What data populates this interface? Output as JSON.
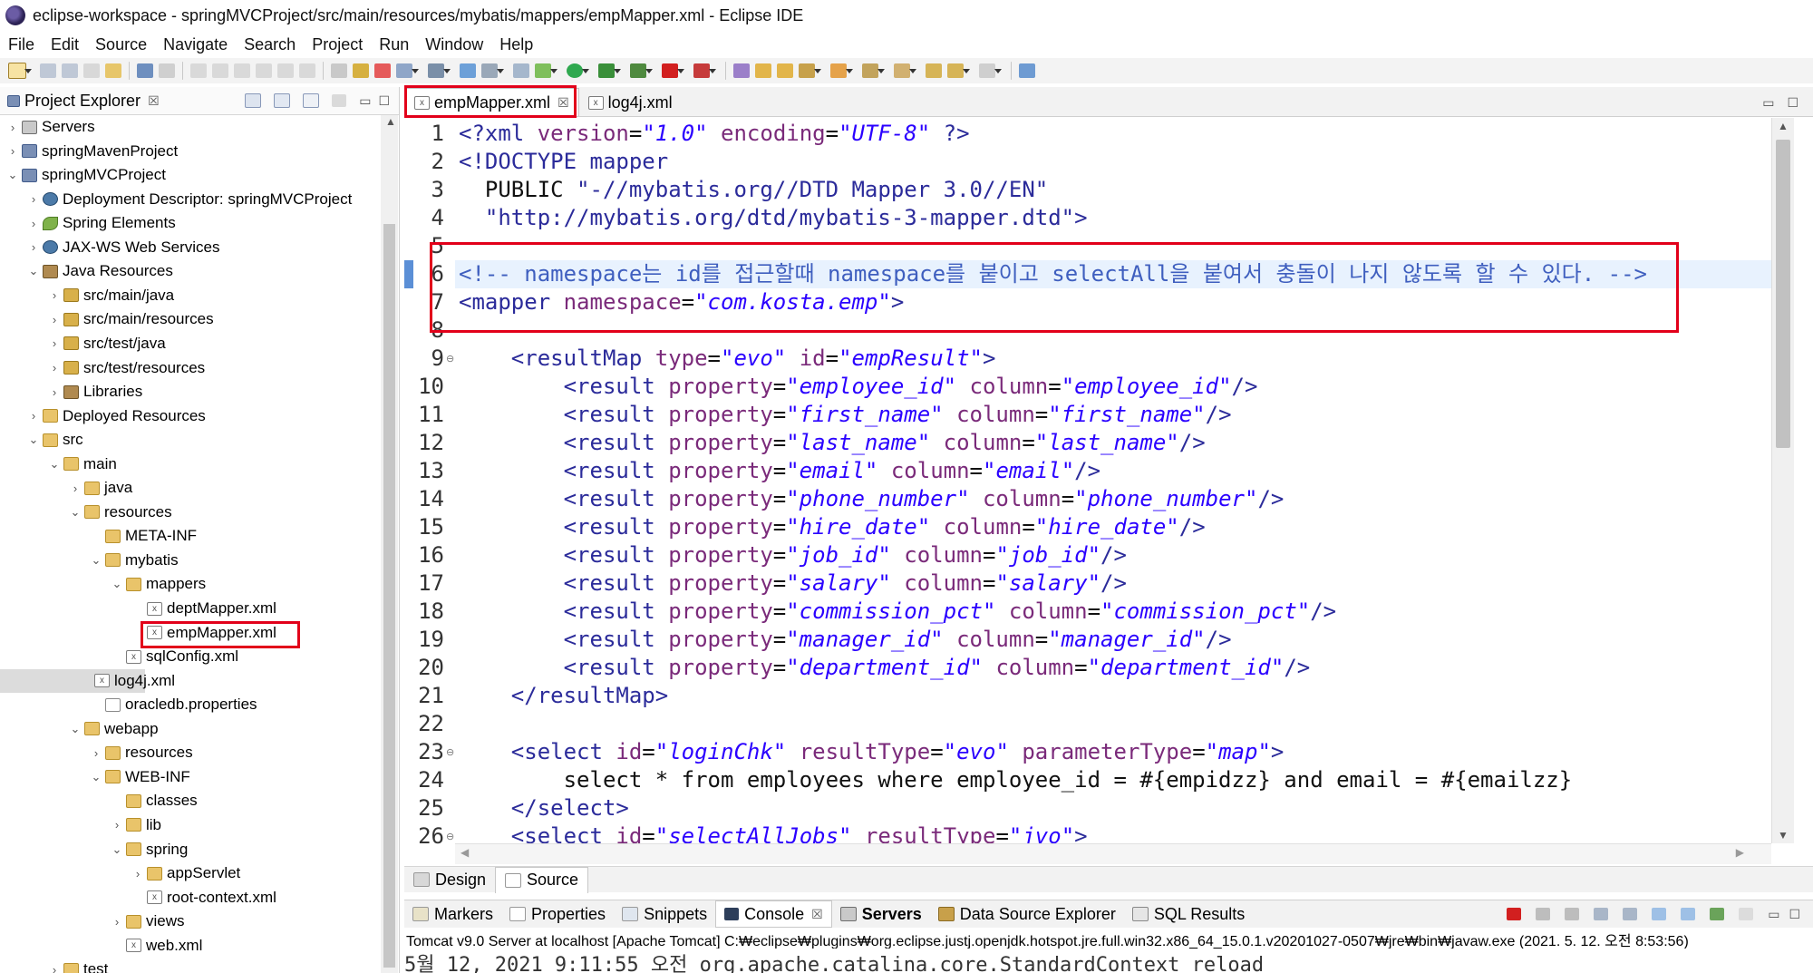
{
  "window": {
    "title": "eclipse-workspace - springMVCProject/src/main/resources/mybatis/mappers/empMapper.xml - Eclipse IDE"
  },
  "menu": [
    "File",
    "Edit",
    "Source",
    "Navigate",
    "Search",
    "Project",
    "Run",
    "Window",
    "Help"
  ],
  "explorer": {
    "title": "Project Explorer",
    "close": "☒",
    "items": [
      {
        "label": "Servers",
        "depth": 0,
        "twisty": "›",
        "icon": "srv"
      },
      {
        "label": "springMavenProject",
        "depth": 0,
        "twisty": "›",
        "icon": "proj"
      },
      {
        "label": "springMVCProject",
        "depth": 0,
        "twisty": "⌄",
        "icon": "proj"
      },
      {
        "label": "Deployment Descriptor: springMVCProject",
        "depth": 1,
        "twisty": "›",
        "icon": "web"
      },
      {
        "label": "Spring Elements",
        "depth": 1,
        "twisty": "›",
        "icon": "leaf"
      },
      {
        "label": "JAX-WS Web Services",
        "depth": 1,
        "twisty": "›",
        "icon": "web"
      },
      {
        "label": "Java Resources",
        "depth": 1,
        "twisty": "⌄",
        "icon": "lib"
      },
      {
        "label": "src/main/java",
        "depth": 2,
        "twisty": "›",
        "icon": "pkg"
      },
      {
        "label": "src/main/resources",
        "depth": 2,
        "twisty": "›",
        "icon": "pkg"
      },
      {
        "label": "src/test/java",
        "depth": 2,
        "twisty": "›",
        "icon": "pkg"
      },
      {
        "label": "src/test/resources",
        "depth": 2,
        "twisty": "›",
        "icon": "pkg"
      },
      {
        "label": "Libraries",
        "depth": 2,
        "twisty": "›",
        "icon": "lib"
      },
      {
        "label": "Deployed Resources",
        "depth": 1,
        "twisty": "›",
        "icon": "folder"
      },
      {
        "label": "src",
        "depth": 1,
        "twisty": "⌄",
        "icon": "folder"
      },
      {
        "label": "main",
        "depth": 2,
        "twisty": "⌄",
        "icon": "folder"
      },
      {
        "label": "java",
        "depth": 3,
        "twisty": "›",
        "icon": "folder"
      },
      {
        "label": "resources",
        "depth": 3,
        "twisty": "⌄",
        "icon": "folder"
      },
      {
        "label": "META-INF",
        "depth": 4,
        "twisty": "",
        "icon": "folder"
      },
      {
        "label": "mybatis",
        "depth": 4,
        "twisty": "⌄",
        "icon": "folder"
      },
      {
        "label": "mappers",
        "depth": 5,
        "twisty": "⌄",
        "icon": "folder"
      },
      {
        "label": "deptMapper.xml",
        "depth": 6,
        "twisty": "",
        "icon": "xml"
      },
      {
        "label": "empMapper.xml",
        "depth": 6,
        "twisty": "",
        "icon": "xml"
      },
      {
        "label": "sqlConfig.xml",
        "depth": 5,
        "twisty": "",
        "icon": "xml"
      },
      {
        "label": "log4j.xml",
        "depth": 4,
        "twisty": "",
        "icon": "xml"
      },
      {
        "label": "oracledb.properties",
        "depth": 4,
        "twisty": "",
        "icon": "file"
      },
      {
        "label": "webapp",
        "depth": 3,
        "twisty": "⌄",
        "icon": "folder"
      },
      {
        "label": "resources",
        "depth": 4,
        "twisty": "›",
        "icon": "folder"
      },
      {
        "label": "WEB-INF",
        "depth": 4,
        "twisty": "⌄",
        "icon": "folder"
      },
      {
        "label": "classes",
        "depth": 5,
        "twisty": "",
        "icon": "folder"
      },
      {
        "label": "lib",
        "depth": 5,
        "twisty": "›",
        "icon": "folder"
      },
      {
        "label": "spring",
        "depth": 5,
        "twisty": "⌄",
        "icon": "folder"
      },
      {
        "label": "appServlet",
        "depth": 6,
        "twisty": "›",
        "icon": "folder"
      },
      {
        "label": "root-context.xml",
        "depth": 6,
        "twisty": "",
        "icon": "xml"
      },
      {
        "label": "views",
        "depth": 5,
        "twisty": "›",
        "icon": "folder"
      },
      {
        "label": "web.xml",
        "depth": 5,
        "twisty": "",
        "icon": "xml"
      },
      {
        "label": "test",
        "depth": 2,
        "twisty": "›",
        "icon": "folder"
      }
    ]
  },
  "editor": {
    "tabs": [
      {
        "label": "empMapper.xml",
        "close": "☒"
      },
      {
        "label": "log4j.xml",
        "close": ""
      }
    ],
    "lines": [
      {
        "n": "1",
        "fold": "",
        "segs": [
          [
            "tag",
            "<?xml "
          ],
          [
            "attr",
            "version"
          ],
          [
            "plain",
            "="
          ],
          [
            "val",
            "\"1.0\""
          ],
          [
            "plain",
            " "
          ],
          [
            "attr",
            "encoding"
          ],
          [
            "plain",
            "="
          ],
          [
            "val",
            "\"UTF-8\""
          ],
          [
            "tag",
            " ?>"
          ]
        ]
      },
      {
        "n": "2",
        "fold": "",
        "segs": [
          [
            "tag",
            "<!DOCTYPE mapper"
          ]
        ]
      },
      {
        "n": "3",
        "fold": "",
        "segs": [
          [
            "plain",
            "  PUBLIC "
          ],
          [
            "tag",
            "\"-//mybatis.org//DTD Mapper 3.0//EN\""
          ]
        ]
      },
      {
        "n": "4",
        "fold": "",
        "segs": [
          [
            "tag",
            "  \"http://mybatis.org/dtd/mybatis-3-mapper.dtd\">"
          ]
        ]
      },
      {
        "n": "5",
        "fold": "",
        "segs": []
      },
      {
        "n": "6",
        "fold": "",
        "segs": [
          [
            "cmt",
            "<!-- namespace는 id를 접근할때 namespace를 붙이고 selectAll을 붙여서 충돌이 나지 않도록 할 수 있다. -->"
          ]
        ]
      },
      {
        "n": "7",
        "fold": "",
        "segs": [
          [
            "tag",
            "<mapper "
          ],
          [
            "attr",
            "namespace"
          ],
          [
            "plain",
            "="
          ],
          [
            "val",
            "\"com.kosta.emp\""
          ],
          [
            "tag",
            ">"
          ]
        ]
      },
      {
        "n": "8",
        "fold": "",
        "segs": []
      },
      {
        "n": "9",
        "fold": "⊖",
        "segs": [
          [
            "plain",
            "    "
          ],
          [
            "tag",
            "<resultMap "
          ],
          [
            "attr",
            "type"
          ],
          [
            "plain",
            "="
          ],
          [
            "val",
            "\"evo\""
          ],
          [
            "plain",
            " "
          ],
          [
            "attr",
            "id"
          ],
          [
            "plain",
            "="
          ],
          [
            "val",
            "\"empResult\""
          ],
          [
            "tag",
            ">"
          ]
        ]
      },
      {
        "n": "10",
        "fold": "",
        "segs": [
          [
            "plain",
            "        "
          ],
          [
            "tag",
            "<result "
          ],
          [
            "attr",
            "property"
          ],
          [
            "plain",
            "="
          ],
          [
            "val",
            "\"employee_id\""
          ],
          [
            "plain",
            " "
          ],
          [
            "attr",
            "column"
          ],
          [
            "plain",
            "="
          ],
          [
            "val",
            "\"employee_id\""
          ],
          [
            "tag",
            "/>"
          ]
        ]
      },
      {
        "n": "11",
        "fold": "",
        "segs": [
          [
            "plain",
            "        "
          ],
          [
            "tag",
            "<result "
          ],
          [
            "attr",
            "property"
          ],
          [
            "plain",
            "="
          ],
          [
            "val",
            "\"first_name\""
          ],
          [
            "plain",
            " "
          ],
          [
            "attr",
            "column"
          ],
          [
            "plain",
            "="
          ],
          [
            "val",
            "\"first_name\""
          ],
          [
            "tag",
            "/>"
          ]
        ]
      },
      {
        "n": "12",
        "fold": "",
        "segs": [
          [
            "plain",
            "        "
          ],
          [
            "tag",
            "<result "
          ],
          [
            "attr",
            "property"
          ],
          [
            "plain",
            "="
          ],
          [
            "val",
            "\"last_name\""
          ],
          [
            "plain",
            " "
          ],
          [
            "attr",
            "column"
          ],
          [
            "plain",
            "="
          ],
          [
            "val",
            "\"last_name\""
          ],
          [
            "tag",
            "/>"
          ]
        ]
      },
      {
        "n": "13",
        "fold": "",
        "segs": [
          [
            "plain",
            "        "
          ],
          [
            "tag",
            "<result "
          ],
          [
            "attr",
            "property"
          ],
          [
            "plain",
            "="
          ],
          [
            "val",
            "\"email\""
          ],
          [
            "plain",
            " "
          ],
          [
            "attr",
            "column"
          ],
          [
            "plain",
            "="
          ],
          [
            "val",
            "\"email\""
          ],
          [
            "tag",
            "/>"
          ]
        ]
      },
      {
        "n": "14",
        "fold": "",
        "segs": [
          [
            "plain",
            "        "
          ],
          [
            "tag",
            "<result "
          ],
          [
            "attr",
            "property"
          ],
          [
            "plain",
            "="
          ],
          [
            "val",
            "\"phone_number\""
          ],
          [
            "plain",
            " "
          ],
          [
            "attr",
            "column"
          ],
          [
            "plain",
            "="
          ],
          [
            "val",
            "\"phone_number\""
          ],
          [
            "tag",
            "/>"
          ]
        ]
      },
      {
        "n": "15",
        "fold": "",
        "segs": [
          [
            "plain",
            "        "
          ],
          [
            "tag",
            "<result "
          ],
          [
            "attr",
            "property"
          ],
          [
            "plain",
            "="
          ],
          [
            "val",
            "\"hire_date\""
          ],
          [
            "plain",
            " "
          ],
          [
            "attr",
            "column"
          ],
          [
            "plain",
            "="
          ],
          [
            "val",
            "\"hire_date\""
          ],
          [
            "tag",
            "/>"
          ]
        ]
      },
      {
        "n": "16",
        "fold": "",
        "segs": [
          [
            "plain",
            "        "
          ],
          [
            "tag",
            "<result "
          ],
          [
            "attr",
            "property"
          ],
          [
            "plain",
            "="
          ],
          [
            "val",
            "\"job_id\""
          ],
          [
            "plain",
            " "
          ],
          [
            "attr",
            "column"
          ],
          [
            "plain",
            "="
          ],
          [
            "val",
            "\"job_id\""
          ],
          [
            "tag",
            "/>"
          ]
        ]
      },
      {
        "n": "17",
        "fold": "",
        "segs": [
          [
            "plain",
            "        "
          ],
          [
            "tag",
            "<result "
          ],
          [
            "attr",
            "property"
          ],
          [
            "plain",
            "="
          ],
          [
            "val",
            "\"salary\""
          ],
          [
            "plain",
            " "
          ],
          [
            "attr",
            "column"
          ],
          [
            "plain",
            "="
          ],
          [
            "val",
            "\"salary\""
          ],
          [
            "tag",
            "/>"
          ]
        ]
      },
      {
        "n": "18",
        "fold": "",
        "segs": [
          [
            "plain",
            "        "
          ],
          [
            "tag",
            "<result "
          ],
          [
            "attr",
            "property"
          ],
          [
            "plain",
            "="
          ],
          [
            "val",
            "\"commission_pct\""
          ],
          [
            "plain",
            " "
          ],
          [
            "attr",
            "column"
          ],
          [
            "plain",
            "="
          ],
          [
            "val",
            "\"commission_pct\""
          ],
          [
            "tag",
            "/>"
          ]
        ]
      },
      {
        "n": "19",
        "fold": "",
        "segs": [
          [
            "plain",
            "        "
          ],
          [
            "tag",
            "<result "
          ],
          [
            "attr",
            "property"
          ],
          [
            "plain",
            "="
          ],
          [
            "val",
            "\"manager_id\""
          ],
          [
            "plain",
            " "
          ],
          [
            "attr",
            "column"
          ],
          [
            "plain",
            "="
          ],
          [
            "val",
            "\"manager_id\""
          ],
          [
            "tag",
            "/>"
          ]
        ]
      },
      {
        "n": "20",
        "fold": "",
        "segs": [
          [
            "plain",
            "        "
          ],
          [
            "tag",
            "<result "
          ],
          [
            "attr",
            "property"
          ],
          [
            "plain",
            "="
          ],
          [
            "val",
            "\"department_id\""
          ],
          [
            "plain",
            " "
          ],
          [
            "attr",
            "column"
          ],
          [
            "plain",
            "="
          ],
          [
            "val",
            "\"department_id\""
          ],
          [
            "tag",
            "/>"
          ]
        ]
      },
      {
        "n": "21",
        "fold": "",
        "segs": [
          [
            "plain",
            "    "
          ],
          [
            "tag",
            "</resultMap>"
          ]
        ]
      },
      {
        "n": "22",
        "fold": "",
        "segs": []
      },
      {
        "n": "23",
        "fold": "⊖",
        "segs": [
          [
            "plain",
            "    "
          ],
          [
            "tag",
            "<select "
          ],
          [
            "attr",
            "id"
          ],
          [
            "plain",
            "="
          ],
          [
            "val",
            "\"loginChk\""
          ],
          [
            "plain",
            " "
          ],
          [
            "attr",
            "resultType"
          ],
          [
            "plain",
            "="
          ],
          [
            "val",
            "\"evo\""
          ],
          [
            "plain",
            " "
          ],
          [
            "attr",
            "parameterType"
          ],
          [
            "plain",
            "="
          ],
          [
            "val",
            "\"map\""
          ],
          [
            "tag",
            ">"
          ]
        ]
      },
      {
        "n": "24",
        "fold": "",
        "segs": [
          [
            "plain",
            "        select * from employees where employee_id = #{empidzz} and email = #{emailzz}"
          ]
        ]
      },
      {
        "n": "25",
        "fold": "",
        "segs": [
          [
            "plain",
            "    "
          ],
          [
            "tag",
            "</select>"
          ]
        ]
      },
      {
        "n": "26",
        "fold": "⊖",
        "segs": [
          [
            "plain",
            "    "
          ],
          [
            "tag",
            "<select "
          ],
          [
            "attr",
            "id"
          ],
          [
            "plain",
            "="
          ],
          [
            "val",
            "\"selectAllJobs\""
          ],
          [
            "plain",
            " "
          ],
          [
            "attr",
            "resultType"
          ],
          [
            "plain",
            "="
          ],
          [
            "val",
            "\"jvo\""
          ],
          [
            "tag",
            ">"
          ]
        ]
      }
    ],
    "bottom_tabs": [
      "Design",
      "Source"
    ]
  },
  "views": {
    "tabs": [
      {
        "label": "Markers",
        "bold": false
      },
      {
        "label": "Properties",
        "bold": false
      },
      {
        "label": "Snippets",
        "bold": false
      },
      {
        "label": "Console",
        "bold": false,
        "close": "☒"
      },
      {
        "label": "Servers",
        "bold": true
      },
      {
        "label": "Data Source Explorer",
        "bold": false
      },
      {
        "label": "SQL Results",
        "bold": false
      }
    ],
    "console_desc": "Tomcat v9.0 Server at localhost [Apache Tomcat] C:₩eclipse₩plugins₩org.eclipse.justj.openjdk.hotspot.jre.full.win32.x86_64_15.0.1.v20201027-0507₩jre₩bin₩javaw.exe  (2021. 5. 12. 오전 8:53:56)",
    "console_out": "5월 12, 2021 9:11:55 오전 org.apache.catalina.core.StandardContext reload"
  },
  "colors": {
    "highlight_box": "#e2001a",
    "tag": "#2b2b9a",
    "attr": "#7a2a7a",
    "value": "#2a00ff",
    "comment": "#3f5fbf"
  }
}
